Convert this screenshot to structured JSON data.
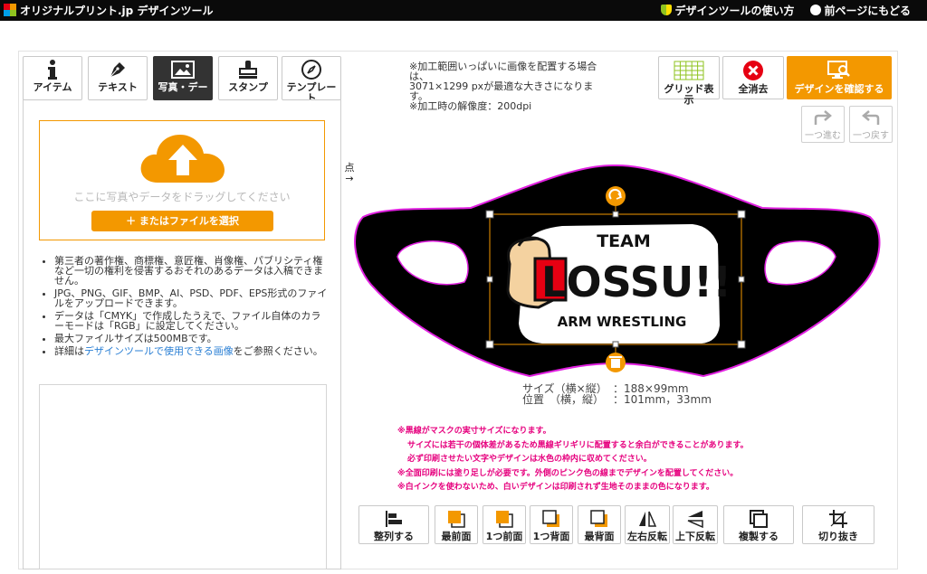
{
  "topbar": {
    "brand": "オリジナルプリント.jp デザインツール",
    "help_link": "デザインツールの使い方",
    "back_link": "前ページにもどる"
  },
  "tabs": [
    {
      "label": "アイテム",
      "icon": "info-icon",
      "active": false
    },
    {
      "label": "テキスト",
      "icon": "pen-icon",
      "active": false
    },
    {
      "label": "写真・デー",
      "icon": "image-icon",
      "active": true
    },
    {
      "label": "スタンプ",
      "icon": "stamp-icon",
      "active": false
    },
    {
      "label": "テンプレー",
      "icon": "compass-icon",
      "active": false
    }
  ],
  "tab_overflow": "ト",
  "dropzone": {
    "text": "ここに写真やデータをドラッグしてください",
    "button": "＋ またはファイルを選択"
  },
  "notes": [
    "第三者の著作権、商標権、意匠権、肖像権、パブリシティ権など一切の権利を侵害するおそれのあるデータは入稿できません。",
    "JPG、PNG、GIF、BMP、AI、PSD、PDF、EPS形式のファイルをアップロードできます。",
    "データは「CMYK」で作成したうえで、ファイル自体のカラーモードは「RGB」に設定してください。",
    "最大ファイルサイズは500MBです。"
  ],
  "notes_link": {
    "prefix": "詳細は",
    "link": "デザインツールで使用できる画像",
    "suffix": "をご参照ください。"
  },
  "side_arrow": "点→",
  "info": [
    "※加工範囲いっぱいに画像を配置する場合は、",
    "3071×1299 pxが最適な大きさになります。",
    "※加工時の解像度：200dpi"
  ],
  "right_buttons": {
    "grid": "グリッド表示",
    "clear": "全消去",
    "confirm": "デザインを確認する"
  },
  "undo": {
    "forward": "一つ進む",
    "back": "一つ戻す"
  },
  "design": {
    "team": "TEAM",
    "name": "LOSSU!!",
    "sub": "ARM WRESTLING"
  },
  "size_info": {
    "size_label": "サイズ（横×縦）",
    "size_value": "：188×99mm",
    "pos_label": "位置　（横，縦）",
    "pos_value": "：101mm，33mm"
  },
  "pink_notes": [
    "※黒線がマスクの実寸サイズになります。",
    "サイズには若干の個体差があるため黒線ギリギリに配置すると余白ができることがあります。",
    "必ず印刷させたい文字やデザインは水色の枠内に収めてください。",
    "※全面印刷には塗り足しが必要です。外側のピンク色の線までデザインを配置してください。",
    "※白インクを使わないため、白いデザインは印刷されず生地そのままの色になります。"
  ],
  "bottom_buttons": [
    "整列する",
    "最前面",
    "1つ前面",
    "1つ背面",
    "最背面",
    "左右反転",
    "上下反転",
    "複製する",
    "切り抜き"
  ],
  "colors": {
    "accent": "#f39800",
    "magenta": "#e6007e",
    "dark": "#0a0a0a"
  }
}
